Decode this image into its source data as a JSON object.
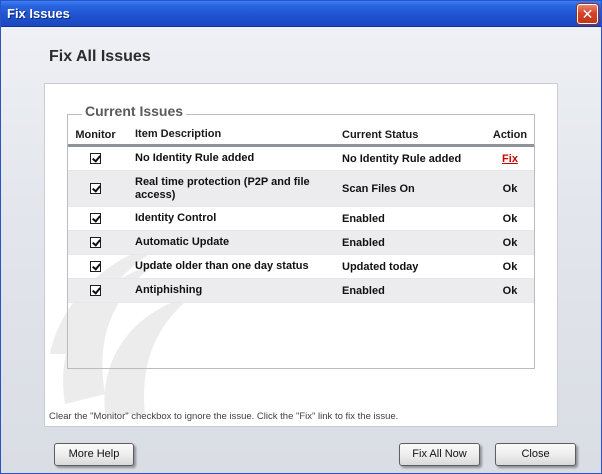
{
  "window": {
    "title": "Fix Issues"
  },
  "page": {
    "title": "Fix All Issues"
  },
  "group": {
    "legend": "Current Issues"
  },
  "table": {
    "headers": {
      "monitor": "Monitor",
      "description": "Item Description",
      "status": "Current Status",
      "action": "Action"
    },
    "rows": [
      {
        "monitored": true,
        "description": "No Identity Rule added",
        "status": "No Identity Rule added",
        "action": "Fix"
      },
      {
        "monitored": true,
        "description": "Real time protection (P2P and file access)",
        "status": "Scan Files On",
        "action": "Ok"
      },
      {
        "monitored": true,
        "description": "Identity Control",
        "status": "Enabled",
        "action": "Ok"
      },
      {
        "monitored": true,
        "description": "Automatic Update",
        "status": "Enabled",
        "action": "Ok"
      },
      {
        "monitored": true,
        "description": "Update older than one day status",
        "status": "Updated today",
        "action": "Ok"
      },
      {
        "monitored": true,
        "description": "Antiphishing",
        "status": "Enabled",
        "action": "Ok"
      }
    ]
  },
  "footer": {
    "note": "Clear the \"Monitor\" checkbox to ignore the issue. Click the \"Fix\" link to fix the issue."
  },
  "buttons": {
    "more_help": "More Help",
    "fix_all_now": "Fix All Now",
    "close": "Close"
  },
  "icons": {
    "close": "close-icon",
    "checkbox": "checkbox-checked-icon"
  },
  "colors": {
    "titlebar": "#2a63de",
    "fix_link": "#cc0000",
    "close_button": "#d2452a"
  }
}
